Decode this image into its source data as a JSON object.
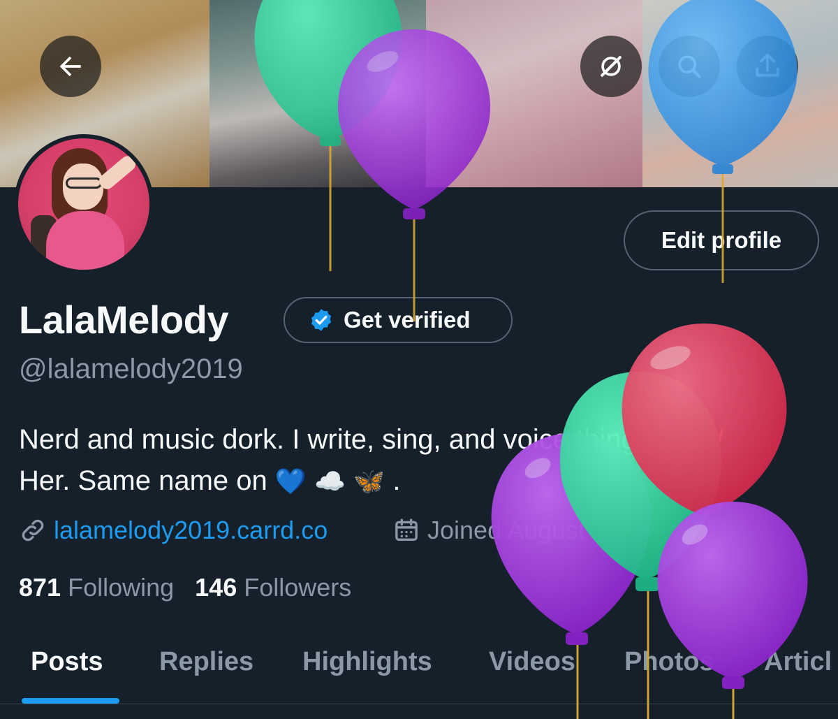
{
  "header": {
    "back_icon": "arrow-left-icon",
    "grok_icon": "grok-icon",
    "search_icon": "search-icon",
    "share_icon": "share-icon"
  },
  "profile": {
    "display_name": "LalaMelody",
    "handle": "@lalamelody2019",
    "edit_profile_label": "Edit profile",
    "get_verified_label": "Get verified",
    "bio_line1": "Nerd and music dork. I write, sing, and voice things. She/",
    "bio_line2": "Her. Same name on",
    "bio_emojis": "💙 ☁️ 🦋",
    "bio_end": ".",
    "website": "lalamelody2019.carrd.co",
    "joined": "Joined August",
    "following_count": "871",
    "following_label": "Following",
    "followers_count": "146",
    "followers_label": "Followers"
  },
  "tabs": [
    {
      "label": "Posts",
      "active": true
    },
    {
      "label": "Replies",
      "active": false
    },
    {
      "label": "Highlights",
      "active": false
    },
    {
      "label": "Videos",
      "active": false
    },
    {
      "label": "Photos",
      "active": false
    },
    {
      "label": "Articl",
      "active": false
    }
  ],
  "colors": {
    "background": "#15202b",
    "accent": "#1d9bf0",
    "secondary_text": "#8b98a5",
    "balloon_green": "#2ed69a",
    "balloon_purple": "#a43be0",
    "balloon_blue": "#3a9ff0",
    "balloon_red": "#e5405f"
  }
}
